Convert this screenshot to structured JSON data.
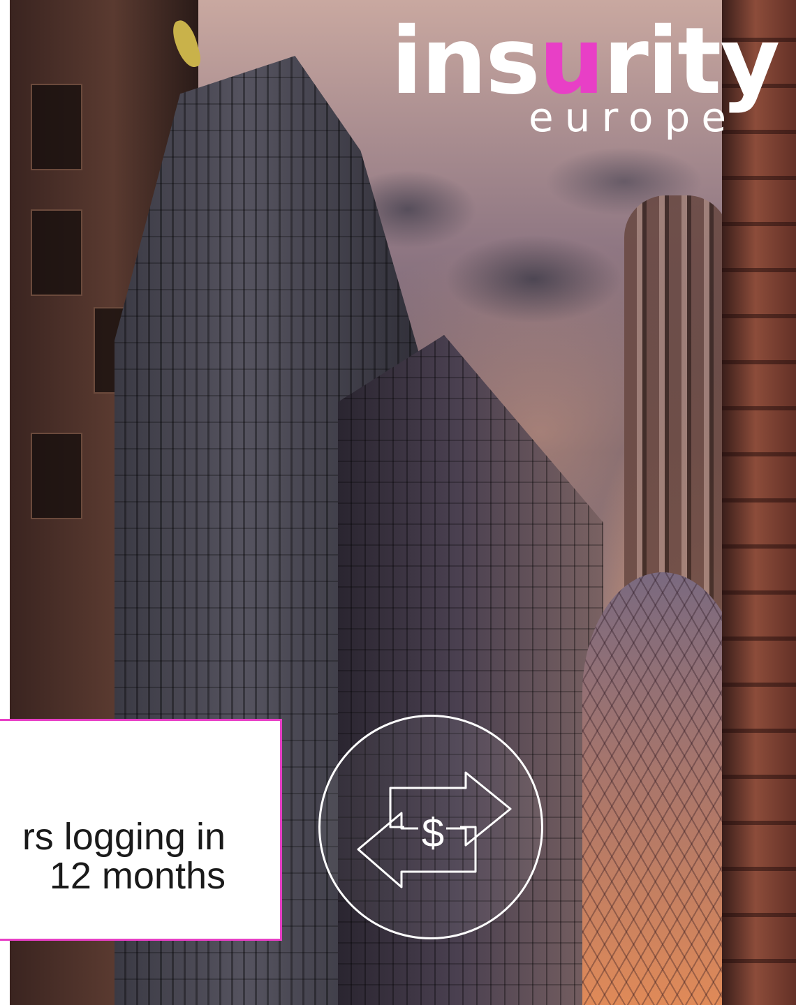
{
  "logo": {
    "word_before": "ins",
    "word_accent": "u",
    "word_after": "rity",
    "subtitle": "europe",
    "accent_color": "#e83fc6"
  },
  "card": {
    "line1": "rs logging in",
    "line2": "12 months",
    "border_color": "#e83fc6"
  },
  "icon": {
    "name": "currency-exchange-arrows-icon",
    "symbol": "$"
  }
}
